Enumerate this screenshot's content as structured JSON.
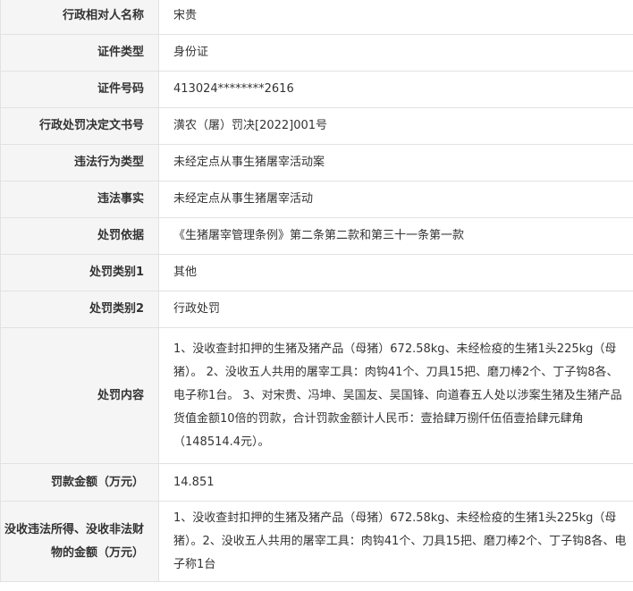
{
  "rows": [
    {
      "label": "行政相对人名称",
      "value": "宋贵"
    },
    {
      "label": "证件类型",
      "value": "身份证"
    },
    {
      "label": "证件号码",
      "value": "413024********2616"
    },
    {
      "label": "行政处罚决定文书号",
      "value": "潢农（屠）罚决[2022]001号"
    },
    {
      "label": "违法行为类型",
      "value": "未经定点从事生猪屠宰活动案"
    },
    {
      "label": "违法事实",
      "value": "未经定点从事生猪屠宰活动"
    },
    {
      "label": "处罚依据",
      "value": "《生猪屠宰管理条例》第二条第二款和第三十一条第一款"
    },
    {
      "label": "处罚类别1",
      "value": "其他"
    },
    {
      "label": "处罚类别2",
      "value": "行政处罚"
    },
    {
      "label": "处罚内容",
      "value": "1、没收查封扣押的生猪及猪产品（母猪）672.58kg、未经检疫的生猪1头225kg（母猪）。 2、没收五人共用的屠宰工具：肉钩41个、刀具15把、磨刀棒2个、丁子钩8各、电子称1台。 3、对宋贵、冯坤、吴国友、吴国锋、向道春五人处以涉案生猪及生猪产品货值金额10倍的罚款，合计罚款金额计人民币：壹拾肆万捌仟伍佰壹拾肆元肆角（148514.4元）。"
    },
    {
      "label": "罚款金额（万元）",
      "value": "14.851"
    },
    {
      "label": "没收违法所得、没收非法财物的金额（万元）",
      "value": "1、没收查封扣押的生猪及猪产品（母猪）672.58kg、未经检疫的生猪1头225kg（母猪）。2、没收五人共用的屠宰工具：肉钩41个、刀具15把、磨刀棒2个、丁子钩8各、电子称1台"
    }
  ]
}
